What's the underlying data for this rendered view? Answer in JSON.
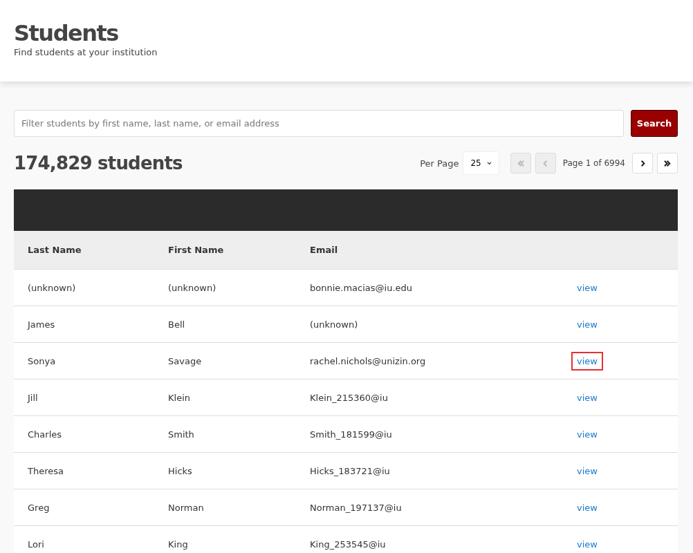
{
  "header": {
    "title": "Students",
    "subtitle": "Find students at your institution"
  },
  "search": {
    "placeholder": "Filter students by first name, last name, or email address",
    "button": "Search"
  },
  "count": "174,829 students",
  "pagination": {
    "per_page_label": "Per Page",
    "per_page": "25",
    "page_text": "Page 1 of 6994",
    "buttons": [
      {
        "kind": "first",
        "disabled": true
      },
      {
        "kind": "prev",
        "disabled": true
      }
    ],
    "buttons_after": [
      {
        "kind": "next",
        "disabled": false
      },
      {
        "kind": "last",
        "disabled": false
      }
    ]
  },
  "table": {
    "columns": [
      "Last Name",
      "First Name",
      "Email"
    ],
    "rows": [
      {
        "last": "(unknown)",
        "first": "(unknown)",
        "email": "bonnie.macias@iu.edu",
        "action": "view",
        "highlighted": false
      },
      {
        "last": "James",
        "first": "Bell",
        "email": "(unknown)",
        "action": "view",
        "highlighted": false
      },
      {
        "last": "Sonya",
        "first": "Savage",
        "email": "rachel.nichols@unizin.org",
        "action": "view",
        "highlighted": true
      },
      {
        "last": "Jill",
        "first": "Klein",
        "email": "Klein_215360@iu",
        "action": "view",
        "highlighted": false
      },
      {
        "last": "Charles",
        "first": "Smith",
        "email": "Smith_181599@iu",
        "action": "view",
        "highlighted": false
      },
      {
        "last": "Theresa",
        "first": "Hicks",
        "email": "Hicks_183721@iu",
        "action": "view",
        "highlighted": false
      },
      {
        "last": "Greg",
        "first": "Norman",
        "email": "Norman_197137@iu",
        "action": "view",
        "highlighted": false
      },
      {
        "last": "Lori",
        "first": "King",
        "email": "King_253545@iu",
        "action": "view",
        "highlighted": false
      }
    ]
  }
}
